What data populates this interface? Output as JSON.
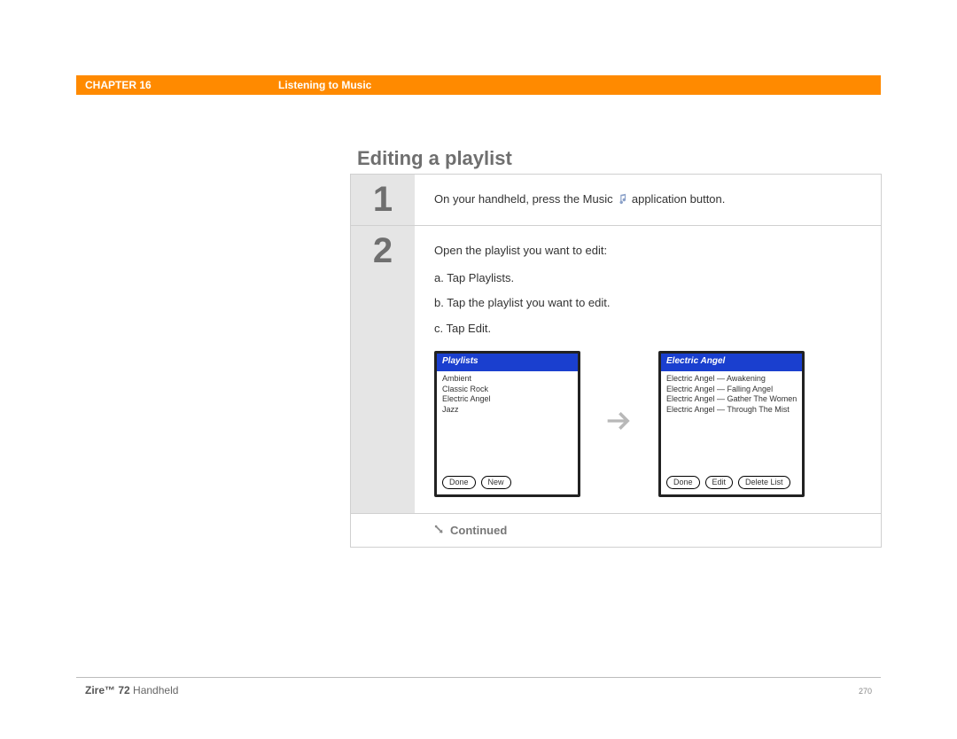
{
  "header": {
    "chapter": "CHAPTER 16",
    "title": "Listening to Music"
  },
  "section_title": "Editing a playlist",
  "steps": [
    {
      "number": "1",
      "text_before_icon": "On your handheld, press the Music ",
      "text_after_icon": " application button."
    },
    {
      "number": "2",
      "intro": "Open the playlist you want to edit:",
      "substeps": [
        "a.  Tap Playlists.",
        "b.  Tap the playlist you want to edit.",
        "c.  Tap Edit."
      ]
    }
  ],
  "screen_left": {
    "title": "Playlists",
    "items": [
      "Ambient",
      "Classic Rock",
      "Electric Angel",
      "Jazz"
    ],
    "buttons": [
      "Done",
      "New"
    ]
  },
  "screen_right": {
    "title": "Electric Angel",
    "items": [
      "Electric Angel — Awakening",
      "Electric Angel — Falling Angel",
      "Electric Angel — Gather The Women",
      "Electric Angel — Through The Mist"
    ],
    "buttons": [
      "Done",
      "Edit",
      "Delete List"
    ]
  },
  "continued_label": "Continued",
  "footer": {
    "product_bold": "Zire™ 72",
    "product_rest": " Handheld",
    "page": "270"
  }
}
